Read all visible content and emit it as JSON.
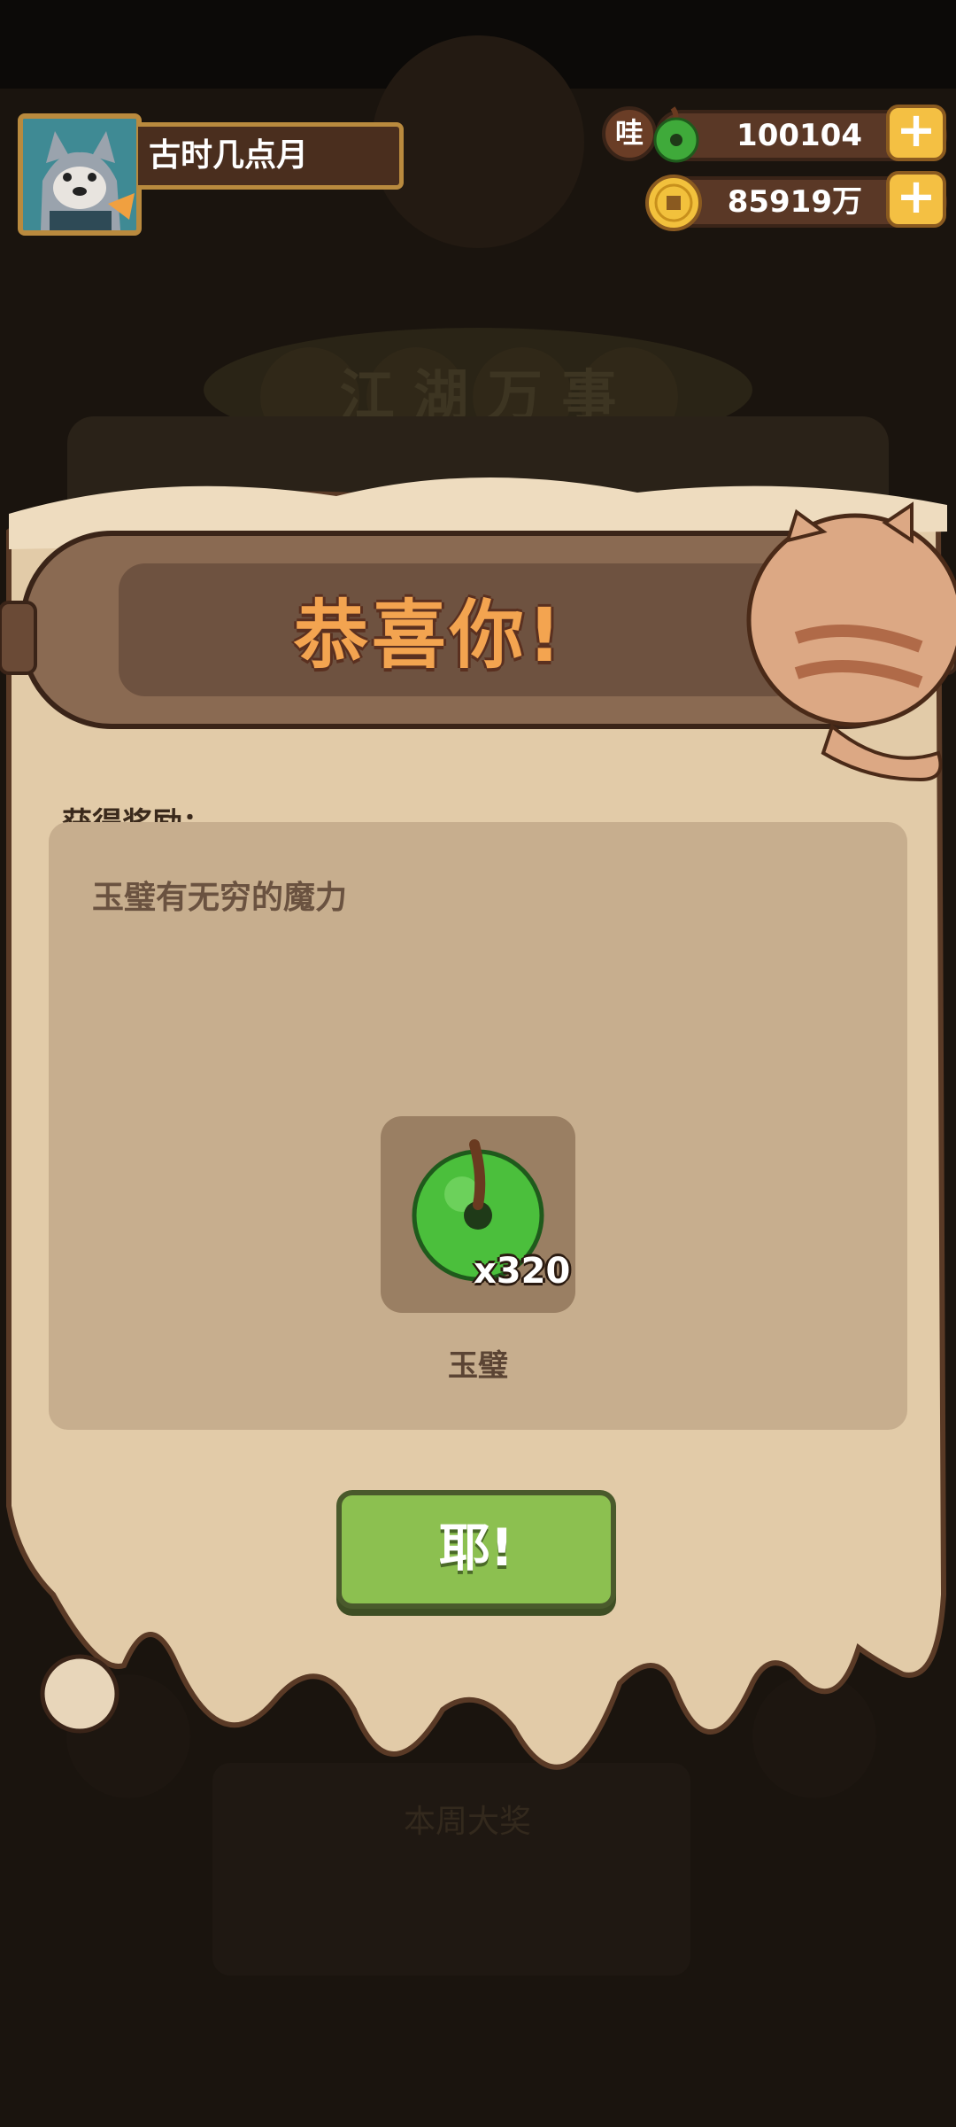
{
  "player": {
    "name": "古时几点月"
  },
  "resources": {
    "badge": "哇",
    "jade_amount": "100104",
    "coin_amount": "85919万"
  },
  "dialog": {
    "title": "恭喜你!",
    "reward_label": "获得奖励：",
    "description": "玉璧有无穷的魔力",
    "item": {
      "name": "玉璧",
      "count": "x320",
      "icon": "jade-disc-icon"
    },
    "confirm_label": "耶!"
  },
  "background": {
    "title_chars": [
      "江",
      "湖",
      "万",
      "事"
    ],
    "bottom_text": "本周大奖"
  },
  "colors": {
    "scroll_paper": "#e2cba8",
    "title_orange": "#f3a450",
    "button_green": "#8cc050",
    "gold": "#f4c043"
  }
}
